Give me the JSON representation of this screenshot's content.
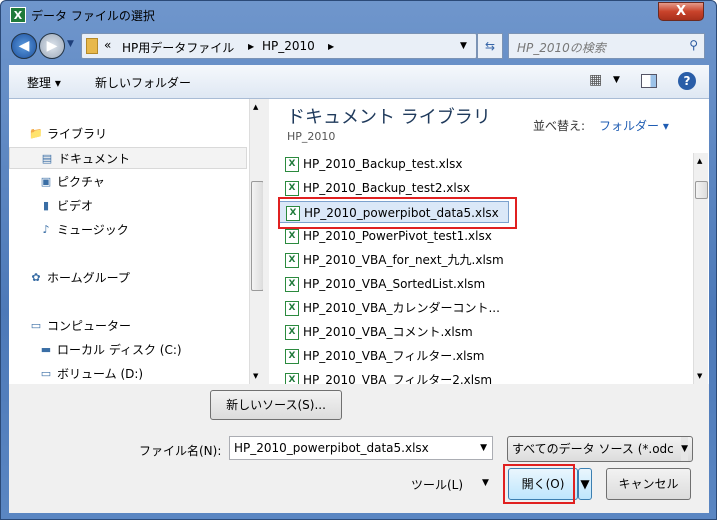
{
  "window": {
    "title": "データ ファイルの選択",
    "close_label": "X"
  },
  "address": {
    "overflow": "«",
    "crumbs": [
      "HP用データファイル",
      "HP_2010"
    ],
    "search_placeholder": "HP_2010の検索"
  },
  "toolbar": {
    "organize": "整理 ▾",
    "new_folder": "新しいフォルダー"
  },
  "nav": {
    "items": [
      {
        "label": "ライブラリ",
        "icon": "library-icon"
      },
      {
        "label": "ドキュメント",
        "icon": "documents-icon",
        "selected": true
      },
      {
        "label": "ピクチャ",
        "icon": "pictures-icon"
      },
      {
        "label": "ビデオ",
        "icon": "video-icon"
      },
      {
        "label": "ミュージック",
        "icon": "music-icon"
      },
      {
        "label": "ホームグループ",
        "icon": "homegroup-icon"
      },
      {
        "label": "コンピューター",
        "icon": "computer-icon"
      },
      {
        "label": "ローカル ディスク (C:)",
        "icon": "disk-icon"
      },
      {
        "label": "ボリューム (D:)",
        "icon": "drive-icon"
      }
    ]
  },
  "library": {
    "title": "ドキュメント ライブラリ",
    "subtitle": "HP_2010",
    "arrange_label": "並べ替え:",
    "arrange_value": "フォルダー ▾"
  },
  "files": [
    "HP_2010_Backup_test.xlsx",
    "HP_2010_Backup_test2.xlsx",
    "HP_2010_powerpibot_data5.xlsx",
    "HP_2010_PowerPivot_test1.xlsx",
    "HP_2010_VBA_for_next_九九.xlsm",
    "HP_2010_VBA_SortedList.xlsm",
    "HP_2010_VBA_カレンダーコント...",
    "HP_2010_VBA_コメント.xlsm",
    "HP_2010_VBA_フィルター.xlsm",
    "HP_2010_VBA_フィルター2.xlsm"
  ],
  "selected_file_index": 2,
  "bottom": {
    "new_source": "新しいソース(S)...",
    "filename_label": "ファイル名(N):",
    "filename_value": "HP_2010_powerpibot_data5.xlsx",
    "filter_value": "すべてのデータ ソース (*.odc",
    "tools": "ツール(L)",
    "open": "開く(O)",
    "cancel": "キャンセル"
  }
}
